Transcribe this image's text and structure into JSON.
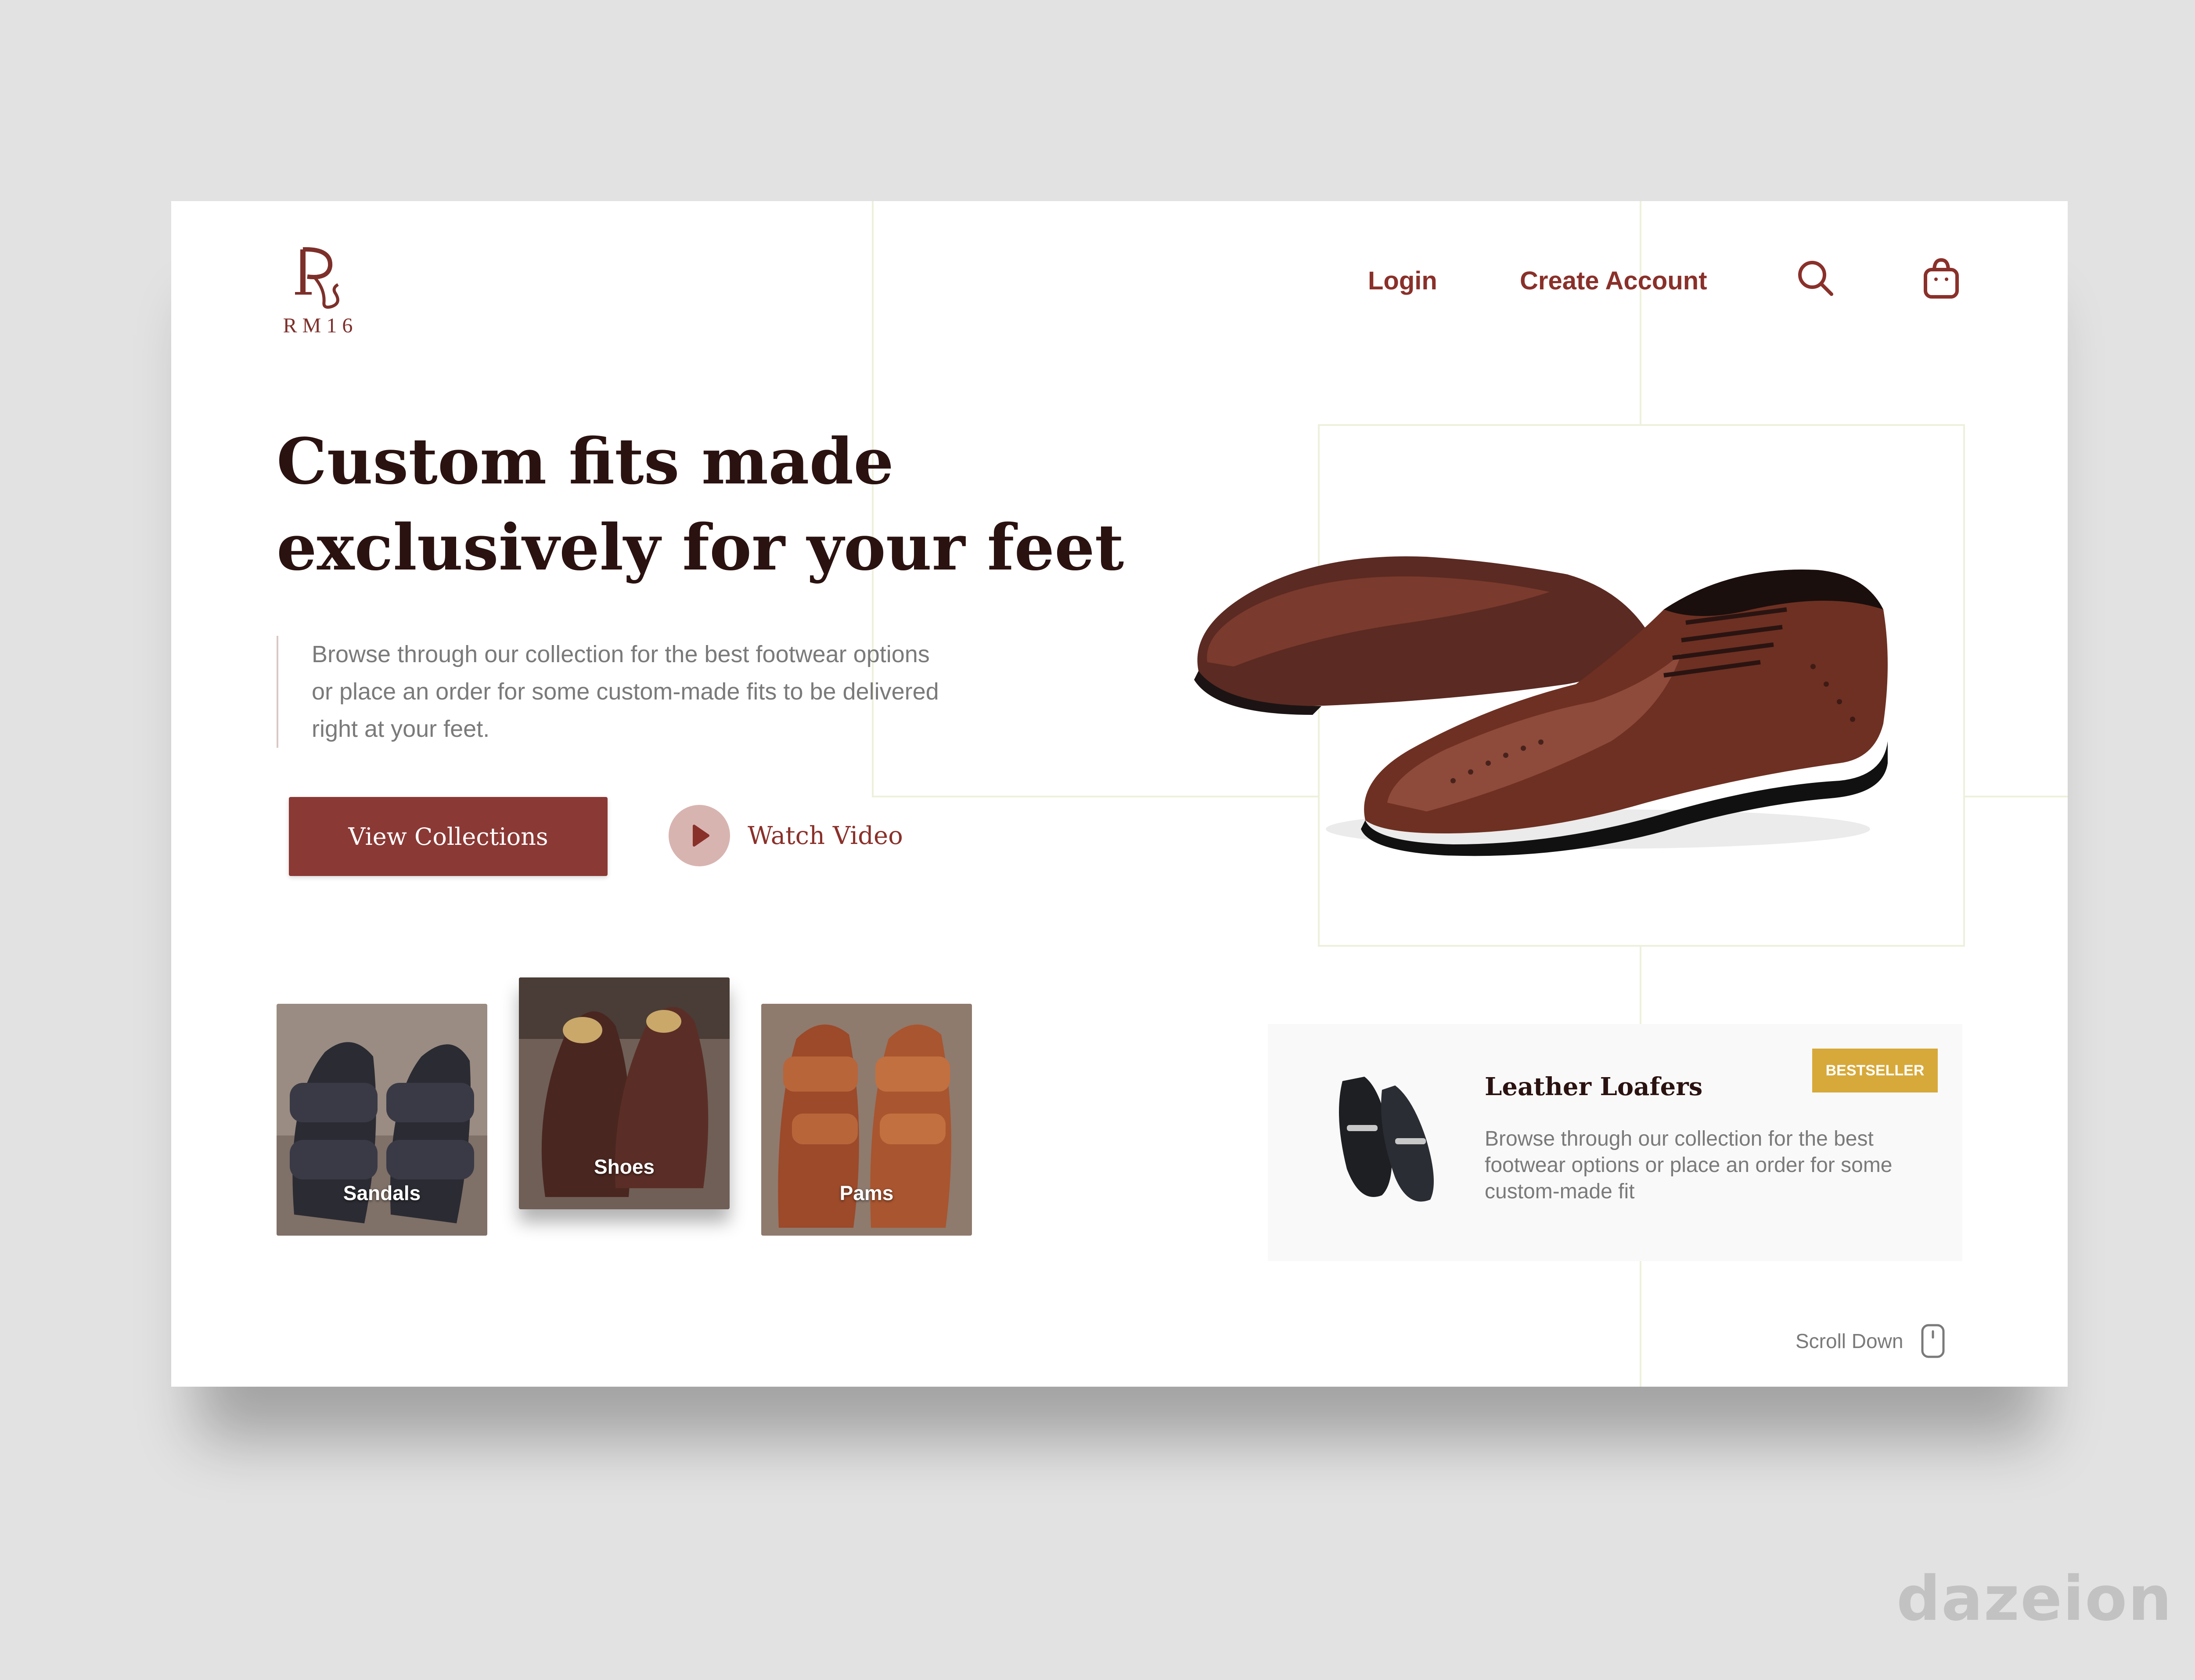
{
  "brand": {
    "name": "RM16",
    "primary_color": "#8b3935",
    "accent_color": "#d7a93a",
    "icon": "rm16-logo-mark"
  },
  "nav": {
    "login": "Login",
    "create_account": "Create Account",
    "search_icon": "search-icon",
    "cart_icon": "shopping-bag-icon"
  },
  "hero": {
    "headline": "Custom fits made exclusively for your feet",
    "description": "Browse through our collection for the best footwear options or place an order for some custom-made fits to be delivered right at your feet.",
    "primary_button": "View Collections",
    "video_button": "Watch Video",
    "video_icon": "play-icon",
    "image": "brown-brogue-oxford-shoes"
  },
  "categories": [
    {
      "label": "Sandals",
      "image": "dark-leather-sandals"
    },
    {
      "label": "Shoes",
      "image": "brown-suede-derby-shoes"
    },
    {
      "label": "Pams",
      "image": "tan-leather-toe-ring-slippers"
    }
  ],
  "featured_product": {
    "badge": "BESTSELLER",
    "name": "Leather Loafers",
    "description": "Browse through our collection for the best footwear options or place an order for some custom-made fit",
    "image": "black-leather-loafers"
  },
  "scroll": {
    "label": "Scroll Down",
    "icon": "mouse-icon"
  },
  "watermark": "dazeion"
}
